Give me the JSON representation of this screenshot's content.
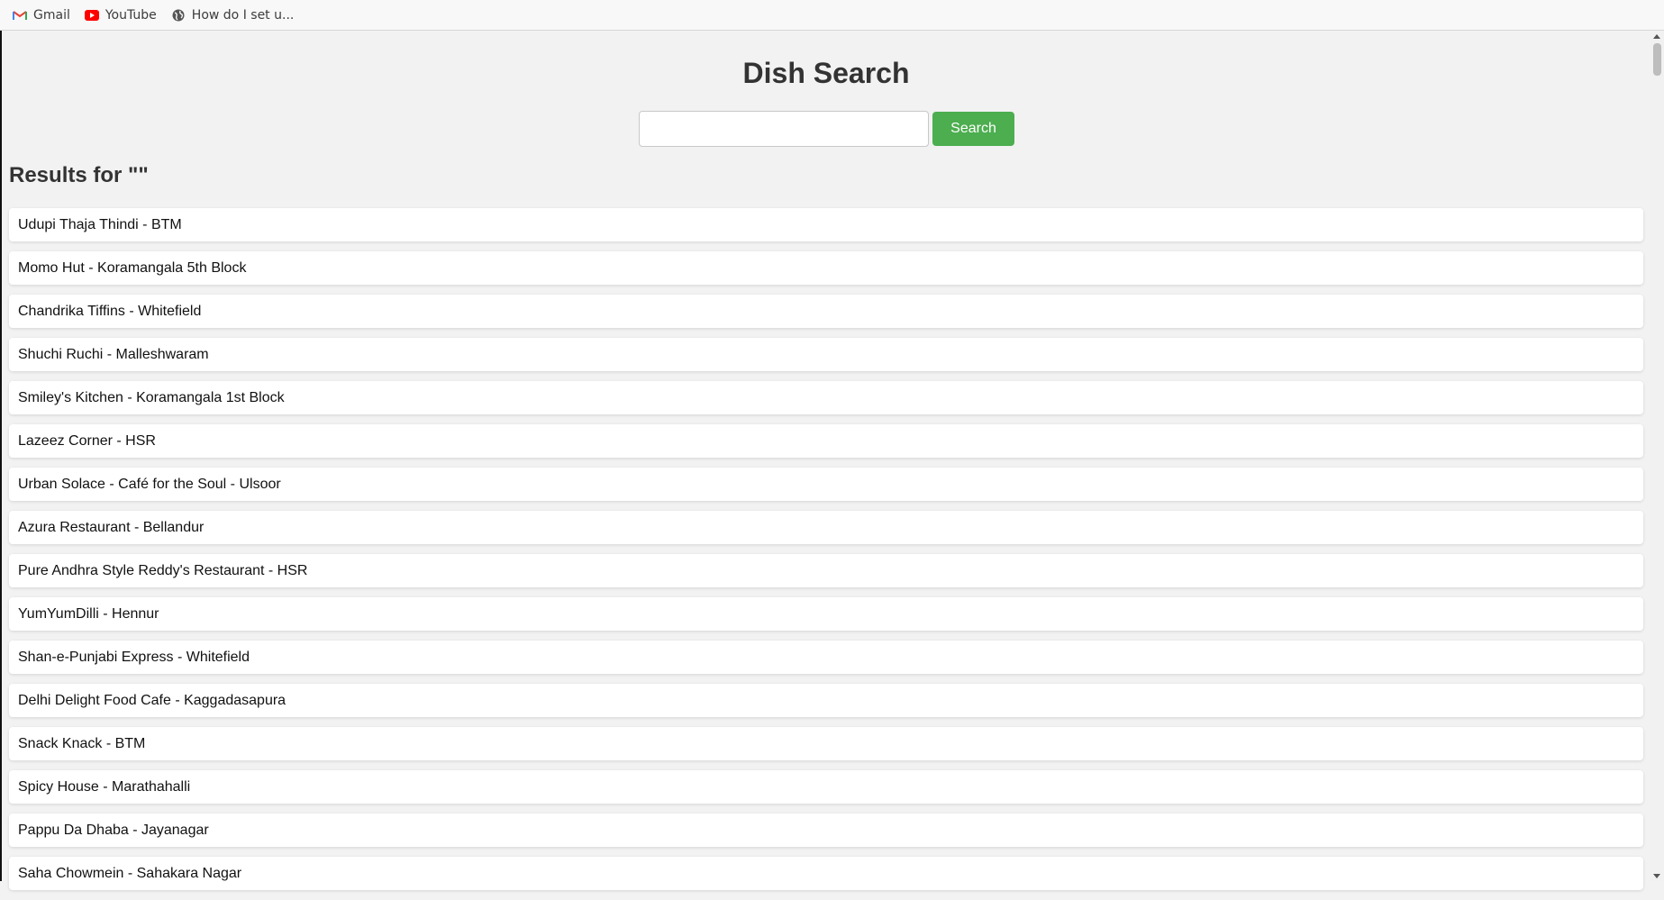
{
  "bookmarks": [
    {
      "label": "Gmail",
      "icon": "gmail-icon"
    },
    {
      "label": "YouTube",
      "icon": "youtube-icon"
    },
    {
      "label": "How do I set u...",
      "icon": "globe-icon"
    }
  ],
  "page": {
    "title": "Dish Search",
    "search": {
      "value": "",
      "placeholder": "",
      "button_label": "Search"
    },
    "results_heading": "Results for \"\"",
    "results": [
      "Udupi Thaja Thindi - BTM",
      "Momo Hut - Koramangala 5th Block",
      "Chandrika Tiffins - Whitefield",
      "Shuchi Ruchi - Malleshwaram",
      "Smiley's Kitchen - Koramangala 1st Block",
      "Lazeez Corner - HSR",
      "Urban Solace - Café for the Soul - Ulsoor",
      "Azura Restaurant - Bellandur",
      "Pure Andhra Style Reddy's Restaurant - HSR",
      "YumYumDilli - Hennur",
      "Shan-e-Punjabi Express - Whitefield",
      "Delhi Delight Food Cafe - Kaggadasapura",
      "Snack Knack - BTM",
      "Spicy House - Marathahalli",
      "Pappu Da Dhaba - Jayanagar",
      "Saha Chowmein - Sahakara Nagar"
    ]
  },
  "colors": {
    "accent": "#4cae4f",
    "background": "#f2f2f2",
    "card": "#ffffff"
  }
}
